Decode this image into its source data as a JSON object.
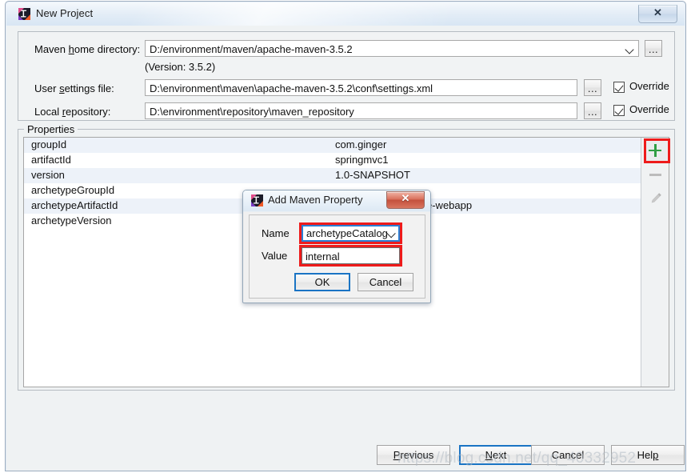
{
  "window": {
    "title": "New Project",
    "icon": "intellij-idea-icon",
    "close_glyph": "✕"
  },
  "form": {
    "maven_home": {
      "label_pre": "Maven ",
      "label_mnemonic": "h",
      "label_post": "ome directory:",
      "value": "D:/environment/maven/apache-maven-3.5.2",
      "browse_label": "...",
      "version_note": "(Version: 3.5.2)"
    },
    "user_settings": {
      "label_pre": "User ",
      "label_mnemonic": "s",
      "label_post": "ettings file:",
      "value": "D:\\environment\\maven\\apache-maven-3.5.2\\conf\\settings.xml",
      "browse_label": "...",
      "override_label": "Override",
      "override_checked": true
    },
    "local_repository": {
      "label_pre": "Local ",
      "label_mnemonic": "r",
      "label_post": "epository:",
      "value": "D:\\environment\\repository\\maven_repository",
      "browse_label": "...",
      "override_label": "Override",
      "override_checked": true
    }
  },
  "properties_panel": {
    "legend": "Properties",
    "rows": [
      {
        "name": "groupId",
        "value": "com.ginger"
      },
      {
        "name": "artifactId",
        "value": "springmvc1"
      },
      {
        "name": "version",
        "value": "1.0-SNAPSHOT"
      },
      {
        "name": "archetypeGroupId",
        "value": ""
      },
      {
        "name": "archetypeArtifactId",
        "value": "e-webapp"
      },
      {
        "name": "archetypeVersion",
        "value": ""
      }
    ],
    "tools": {
      "add_label": "+",
      "add_icon": "plus-icon",
      "add_color": "#2f9e44",
      "remove_icon": "minus-icon",
      "edit_icon": "pencil-icon",
      "highlight_color": "#ee1b1b"
    }
  },
  "footer": {
    "previous": {
      "pre": "",
      "mnemonic": "P",
      "post": "revious"
    },
    "next": {
      "pre": "",
      "mnemonic": "N",
      "post": "ext",
      "is_default": true
    },
    "cancel": {
      "pre": "Cancel",
      "mnemonic": "",
      "post": ""
    },
    "help": {
      "pre": "Hel",
      "mnemonic": "p",
      "post": ""
    }
  },
  "dialog": {
    "title": "Add Maven Property",
    "icon": "intellij-idea-icon",
    "close_glyph": "✕",
    "name_label": "Name",
    "name_value": "archetypeCatalog",
    "value_label": "Value",
    "value_value": "internal",
    "ok_label": "OK",
    "cancel_label": "Cancel",
    "focus_color": "#2a7fd4",
    "highlight_color": "#ee1b1b"
  },
  "watermark": {
    "text": "https://blog.csdn.net/qq_40332952"
  }
}
